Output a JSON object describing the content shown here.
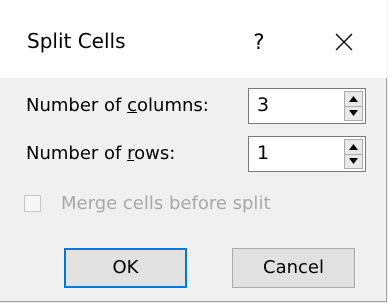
{
  "dialog": {
    "title": "Split Cells",
    "help_label": "?"
  },
  "columns": {
    "label_pre": "Number of ",
    "label_accel": "c",
    "label_post": "olumns:",
    "value": "3"
  },
  "rows": {
    "label_pre": "Number of ",
    "label_accel": "r",
    "label_post": "ows:",
    "value": "1"
  },
  "merge": {
    "label": "Merge cells before split",
    "checked": false,
    "enabled": false
  },
  "buttons": {
    "ok": "OK",
    "cancel": "Cancel"
  },
  "colors": {
    "default_button_border": "#0078d7",
    "disabled_text": "#a8a8a8"
  }
}
